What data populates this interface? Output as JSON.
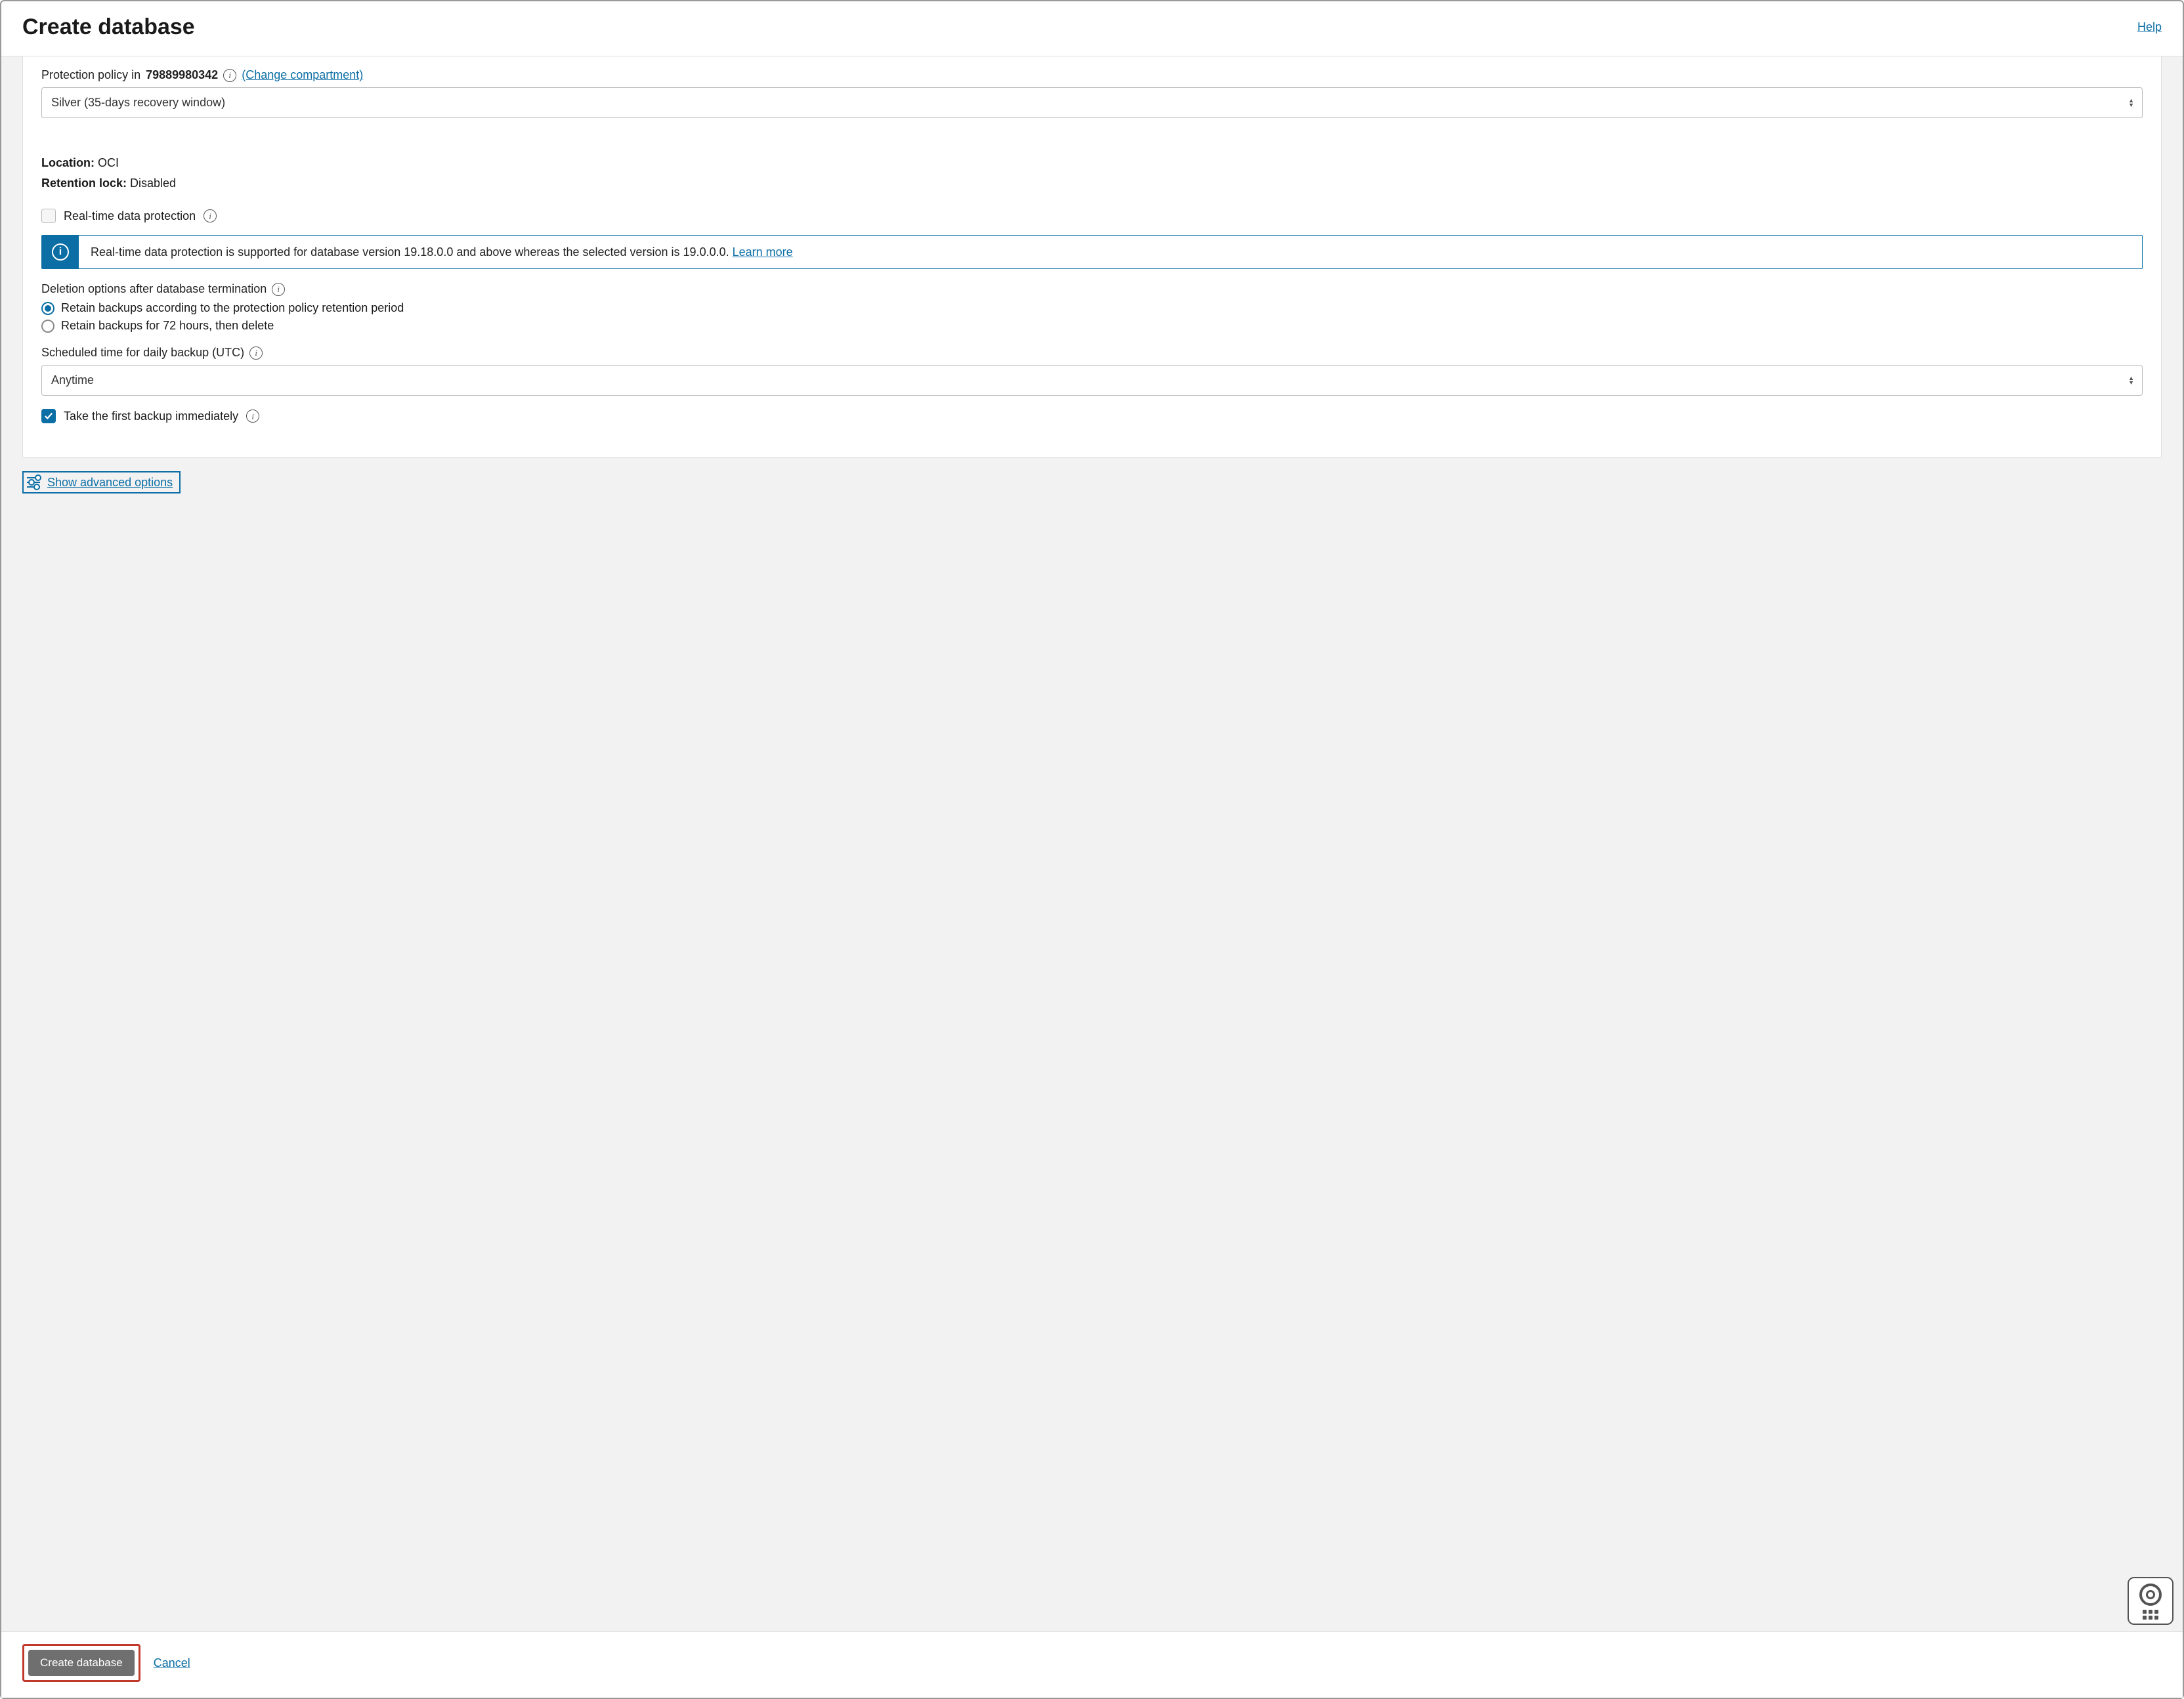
{
  "header": {
    "title": "Create database",
    "help": "Help"
  },
  "policy": {
    "label_prefix": "Protection policy in",
    "compartment_id": "79889980342",
    "change_link": "(Change compartment)",
    "selected": "Silver (35-days recovery window)"
  },
  "location": {
    "label": "Location:",
    "value": "OCI"
  },
  "retention_lock": {
    "label": "Retention lock:",
    "value": "Disabled"
  },
  "realtime": {
    "label": "Real-time data protection",
    "checked": false
  },
  "banner": {
    "text": "Real-time data protection is supported for database version 19.18.0.0 and above whereas the selected version is 19.0.0.0. ",
    "learn_more": "Learn more"
  },
  "deletion": {
    "label": "Deletion options after database termination",
    "options": [
      {
        "label": "Retain backups according to the protection policy retention period",
        "selected": true
      },
      {
        "label": "Retain backups for 72 hours, then delete",
        "selected": false
      }
    ]
  },
  "schedule": {
    "label": "Scheduled time for daily backup (UTC)",
    "selected": "Anytime"
  },
  "first_backup": {
    "label": "Take the first backup immediately",
    "checked": true
  },
  "advanced": {
    "label": "Show advanced options"
  },
  "footer": {
    "create": "Create database",
    "cancel": "Cancel"
  }
}
